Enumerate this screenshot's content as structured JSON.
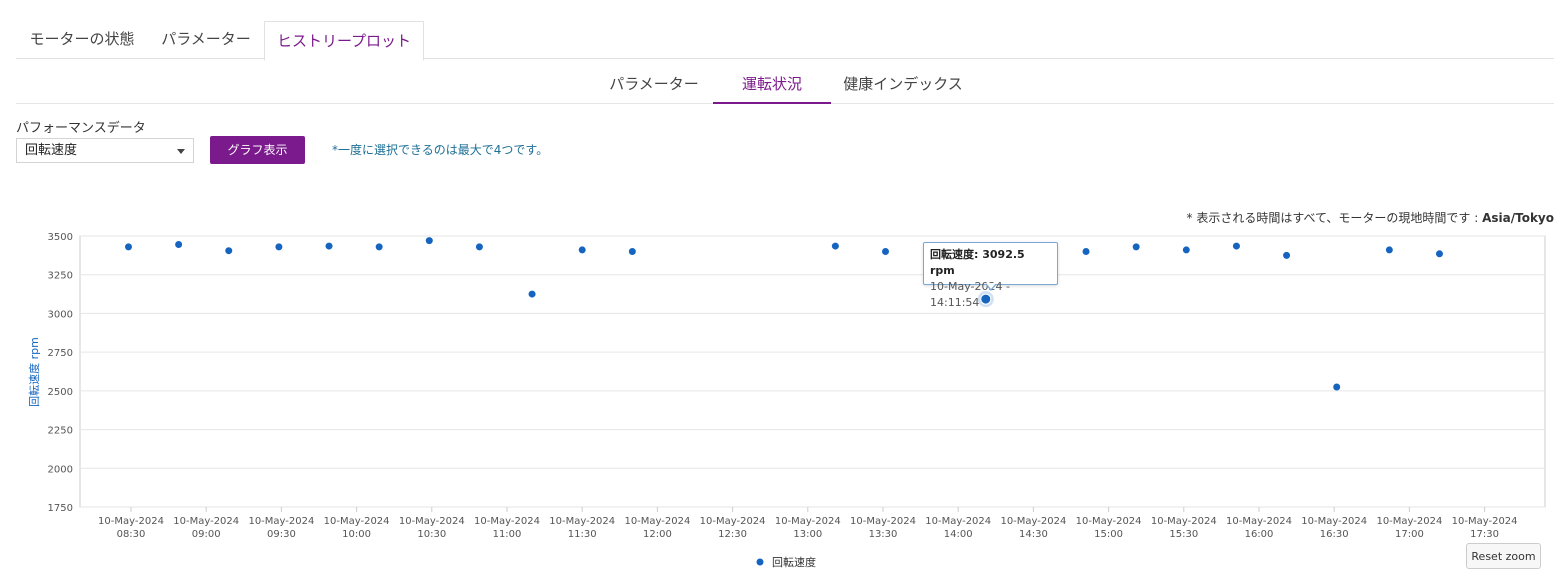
{
  "top_tabs": [
    {
      "label": "モーターの状態",
      "active": false
    },
    {
      "label": "パラメーター",
      "active": false
    },
    {
      "label": "ヒストリープロット",
      "active": true
    }
  ],
  "sub_tabs": [
    {
      "label": "パラメーター",
      "active": false
    },
    {
      "label": "運転状況",
      "active": true
    },
    {
      "label": "健康インデックス",
      "active": false
    }
  ],
  "controls": {
    "performance_label": "パフォーマンスデータ",
    "selected_metric": "回転速度",
    "graph_button": "グラフ表示",
    "note": "*一度に選択できるのは最大で4つです。"
  },
  "timezone_note": {
    "prefix": "* 表示される時間はすべて、モーターの現地時間です : ",
    "zone": "Asia/Tokyo"
  },
  "tooltip": {
    "series_label": "回転速度:",
    "value": "3092.5 rpm",
    "time": "10-May-2024 - 14:11:54"
  },
  "reset_zoom_label": "Reset zoom",
  "colors": {
    "accent": "#7b1a8c",
    "series": "#1565c0",
    "note": "#1d6f95"
  },
  "chart_data": {
    "type": "scatter",
    "ylabel": "回転速度 rpm",
    "ylim": [
      1750,
      3500
    ],
    "yticks": [
      1750,
      2000,
      2250,
      2500,
      2750,
      3000,
      3250,
      3500
    ],
    "xticks": [
      "08:30",
      "09:00",
      "09:30",
      "10:00",
      "10:30",
      "11:00",
      "11:30",
      "12:00",
      "12:30",
      "13:00",
      "13:30",
      "14:00",
      "14:30",
      "15:00",
      "15:30",
      "16:00",
      "16:30",
      "17:00",
      "17:30"
    ],
    "xtick_date": "10-May-2024",
    "x_unit": "time",
    "series": [
      {
        "name": "回転速度",
        "color": "#1565c0",
        "points": [
          {
            "x": "08:29",
            "y": 3430
          },
          {
            "x": "08:49",
            "y": 3445
          },
          {
            "x": "09:09",
            "y": 3405
          },
          {
            "x": "09:29",
            "y": 3430
          },
          {
            "x": "09:49",
            "y": 3435
          },
          {
            "x": "10:09",
            "y": 3430
          },
          {
            "x": "10:29",
            "y": 3470
          },
          {
            "x": "10:49",
            "y": 3430
          },
          {
            "x": "11:10",
            "y": 3125
          },
          {
            "x": "11:30",
            "y": 3410
          },
          {
            "x": "11:50",
            "y": 3400
          },
          {
            "x": "13:11",
            "y": 3435
          },
          {
            "x": "13:31",
            "y": 3400
          },
          {
            "x": "14:11",
            "y": 3092.5
          },
          {
            "x": "14:31",
            "y": 3405
          },
          {
            "x": "14:51",
            "y": 3400
          },
          {
            "x": "15:11",
            "y": 3430
          },
          {
            "x": "15:31",
            "y": 3410
          },
          {
            "x": "15:51",
            "y": 3435
          },
          {
            "x": "16:11",
            "y": 3375
          },
          {
            "x": "16:31",
            "y": 2525
          },
          {
            "x": "16:52",
            "y": 3410
          },
          {
            "x": "17:12",
            "y": 3385
          }
        ],
        "highlighted_index": 13
      }
    ]
  }
}
